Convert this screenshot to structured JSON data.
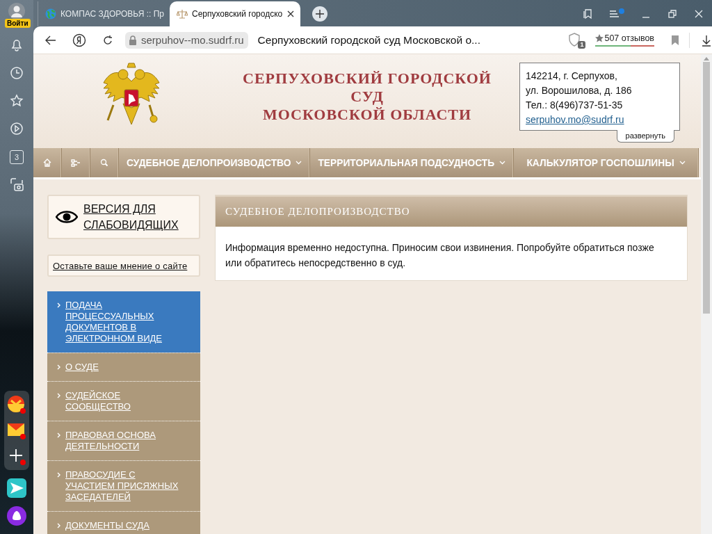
{
  "browser": {
    "profile_label": "Войти",
    "rail_badge": "3",
    "tabs": [
      {
        "title": "КОМПАС ЗДОРОВЬЯ :: Пр",
        "selected": false
      },
      {
        "title": "Серпуховский городско",
        "selected": true
      }
    ],
    "address": "serpuhov--mo.sudrf.ru",
    "page_title": "Серпуховский городской суд Московской о...",
    "tracker_badge": "1",
    "reviews": "507 отзывов"
  },
  "header": {
    "title_lines": [
      "СЕРПУХОВСКИЙ ГОРОДСКОЙ",
      "СУД",
      "МОСКОВСКОЙ ОБЛАСТИ"
    ],
    "contacts": {
      "address_line_1": "142214, г. Серпухов,",
      "address_line_2": "ул. Ворошилова, д. 186",
      "phone": "Тел.: 8(496)737-51-35",
      "email": "serpuhov.mo@sudrf.ru",
      "expand": "развернуть"
    }
  },
  "nav": {
    "items": [
      {
        "label": "СУДЕБНОЕ ДЕЛОПРОИЗВОДСТВО",
        "dropdown": true
      },
      {
        "label": "ТЕРРИТОРИАЛЬНАЯ ПОДСУДНОСТЬ",
        "dropdown": true
      },
      {
        "label": "КАЛЬКУЛЯТОР ГОСПОШЛИНЫ",
        "dropdown": true
      }
    ]
  },
  "sidebar": {
    "accessibility_link": "ВЕРСИЯ ДЛЯ СЛАБОВИДЯЩИХ",
    "feedback_link": "Оставьте ваше мнение о сайте",
    "items": [
      {
        "label": "ПОДАЧА ПРОЦЕССУАЛЬНЫХ ДОКУМЕНТОВ В ЭЛЕКТРОННОМ ВИДЕ",
        "selected": true
      },
      {
        "label": "О СУДЕ",
        "selected": false
      },
      {
        "label": "СУДЕЙСКОЕ СООБЩЕСТВО",
        "selected": false
      },
      {
        "label": "ПРАВОВАЯ ОСНОВА ДЕЯТЕЛЬНОСТИ",
        "selected": false
      },
      {
        "label": "ПРАВОСУДИЕ С УЧАСТИЕМ ПРИСЯЖНЫХ ЗАСЕДАТЕЛЕЙ",
        "selected": false
      },
      {
        "label": "ДОКУМЕНТЫ СУДА",
        "selected": false
      }
    ]
  },
  "panel": {
    "title": "СУДЕБНОЕ ДЕЛОПРОИЗВОДСТВО",
    "message": "Информация временно недоступна. Приносим свои извинения. Попробуйте обратиться позже или обратитесь непосредственно в суд."
  }
}
